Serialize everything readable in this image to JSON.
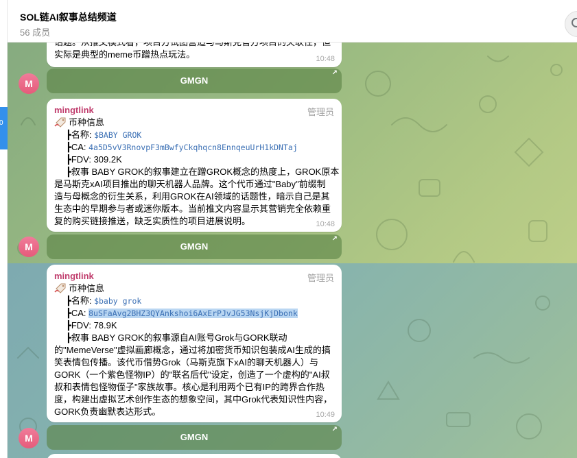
{
  "header": {
    "title": "SOL链AI叙事总结频道",
    "subtitle": "56 成员",
    "search_icon": "search-icon"
  },
  "sidebar": {
    "selected_fragment": "0"
  },
  "messages": [
    {
      "text_lines": [
        "话题。从推文模式看，项目方试图营造与马斯克官方项目的关联性，但",
        "实际是典型的meme币蹭热点玩法。"
      ],
      "time": "10:48",
      "button": "GMGN",
      "avatar": "M"
    },
    {
      "sender": "mingtlink",
      "badge": "管理员",
      "coin_header": "币种信息",
      "name_label": "┣名称: ",
      "name_value": "$BABY GROK",
      "ca_label": "┣CA: ",
      "ca_value": "4a5D5vV3RnovpF3mBwfyCkqhqcn8EnnqeuUrH1kDNTaj",
      "fdv": "┣FDV: 309.2K",
      "narrative_lines": [
        "┣叙事 BABY GROK的叙事建立在蹭GROK概念的热度上，GROK原本",
        "是马斯克xAI项目推出的聊天机器人品牌。这个代币通过\"Baby\"前缀制",
        "造与母概念的衍生关系，利用GROK在AI领域的话题性，暗示自己是其",
        "生态中的早期参与者或迷你版本。当前推文内容显示其营销完全依赖重",
        "复的购买链接推送，缺乏实质性的项目进展说明。"
      ],
      "time": "10:48",
      "button": "GMGN",
      "avatar": "M"
    },
    {
      "sender": "mingtlink",
      "badge": "管理员",
      "coin_header": "币种信息",
      "name_label": "┣名称: ",
      "name_value": "$baby grok",
      "ca_label": "┣CA: ",
      "ca_value": "8uSFaAvg2BHZ3QYAnkshoi6AxErPJvJG53NsjKjDbonk",
      "fdv": "┣FDV: 78.9K",
      "narrative_lines": [
        "┣叙事 BABY GROK的叙事源自AI账号Grok与GORK联动",
        "的\"MemeVerse\"虚拟画廊概念，通过将加密货币知识包装成AI生成的搞",
        "笑表情包传播。该代币借势Grok（马斯克旗下xAI的聊天机器人）与",
        "GORK（一个紫色怪物IP）的\"联名后代\"设定，创造了一个虚构的\"AI叔",
        "叔和表情包怪物侄子\"家族故事。核心是利用两个已有IP的跨界合作热",
        "度，构建出虚拟艺术创作生态的想象空间，其中Grok代表知识性内容，",
        "GORK负责幽默表达形式。"
      ],
      "time": "10:49",
      "button": "GMGN",
      "avatar": "M"
    }
  ],
  "colors": {
    "sender": "#c03d6d",
    "accent": "#3390ec",
    "avatar": "#e55b7a"
  }
}
